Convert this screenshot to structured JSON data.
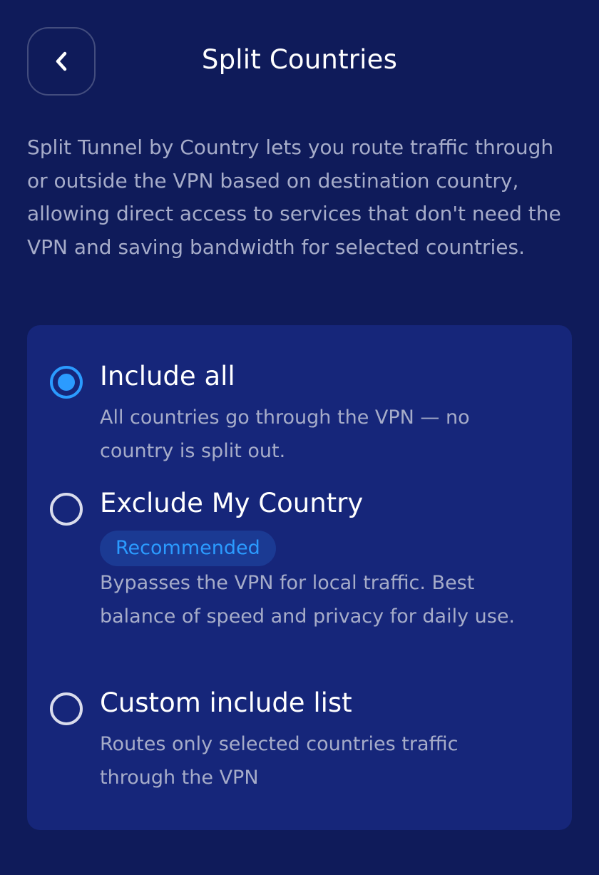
{
  "header": {
    "title": "Split Countries",
    "back_icon": "chevron-left-icon"
  },
  "description": "Split Tunnel by Country lets you route traffic through or outside the VPN based on destination country, allowing direct access to services that don't need the VPN and saving bandwidth for selected countries.",
  "options": [
    {
      "title": "Include all",
      "description": "All countries go through the VPN — no country is split out.",
      "selected": true
    },
    {
      "title": "Exclude My Country",
      "badge": "Recommended",
      "description": "Bypasses the VPN for local traffic. Best balance of speed and privacy for daily use.",
      "selected": false
    },
    {
      "title": "Custom include list",
      "description": "Routes only selected countries traffic through the VPN",
      "selected": false
    }
  ],
  "colors": {
    "background": "#0f1b5a",
    "card": "#16267a",
    "accent": "#2b9bff",
    "muted_text": "#a6acc9"
  }
}
